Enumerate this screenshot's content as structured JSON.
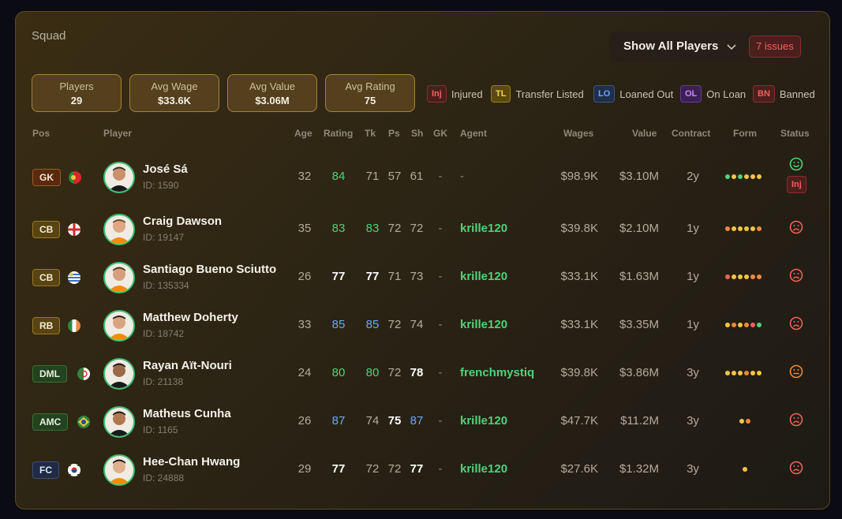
{
  "squad_title": "Squad",
  "filter": {
    "label": "Show All Players",
    "issues": "7 issues"
  },
  "stats": [
    {
      "label": "Players",
      "value": "29"
    },
    {
      "label": "Avg Wage",
      "value": "$33.6K"
    },
    {
      "label": "Avg Value",
      "value": "$3.06M"
    },
    {
      "label": "Avg Rating",
      "value": "75"
    }
  ],
  "legend": [
    {
      "code": "Inj",
      "text": "Injured"
    },
    {
      "code": "TL",
      "text": "Transfer Listed"
    },
    {
      "code": "LO",
      "text": "Loaned Out"
    },
    {
      "code": "OL",
      "text": "On Loan"
    },
    {
      "code": "BN",
      "text": "Banned"
    }
  ],
  "headers": {
    "pos": "Pos",
    "player": "Player",
    "age": "Age",
    "rating": "Rating",
    "tk": "Tk",
    "ps": "Ps",
    "sh": "Sh",
    "gk": "GK",
    "agent": "Agent",
    "wages": "Wages",
    "value": "Value",
    "contract": "Contract",
    "form": "Form",
    "status": "Status"
  },
  "players": [
    {
      "pos": "GK",
      "name": "José Sá",
      "id": "ID: 1590",
      "age": "32",
      "rating": "84",
      "tk": "71",
      "ps": "57",
      "sh": "61",
      "gk": "-",
      "agent": "-",
      "wages": "$98.9K",
      "value": "$3.10M",
      "contract": "2y",
      "status": "happy",
      "injured": "Inj"
    },
    {
      "pos": "CB",
      "name": "Craig Dawson",
      "id": "ID: 19147",
      "age": "35",
      "rating": "83",
      "tk": "83",
      "ps": "72",
      "sh": "72",
      "gk": "-",
      "agent": "krille120",
      "wages": "$39.8K",
      "value": "$2.10M",
      "contract": "1y",
      "status": "sad"
    },
    {
      "pos": "CB",
      "name": "Santiago Bueno Sciutto",
      "id": "ID: 135334",
      "age": "26",
      "rating": "77",
      "tk": "77",
      "ps": "71",
      "sh": "73",
      "gk": "-",
      "agent": "krille120",
      "wages": "$33.1K",
      "value": "$1.63M",
      "contract": "1y",
      "status": "sad"
    },
    {
      "pos": "RB",
      "name": "Matthew Doherty",
      "id": "ID: 18742",
      "age": "33",
      "rating": "85",
      "tk": "85",
      "ps": "72",
      "sh": "74",
      "gk": "-",
      "agent": "krille120",
      "wages": "$33.1K",
      "value": "$3.35M",
      "contract": "1y",
      "status": "sad"
    },
    {
      "pos": "DML",
      "name": "Rayan Aït-Nouri",
      "id": "ID: 21138",
      "age": "24",
      "rating": "80",
      "tk": "80",
      "ps": "72",
      "sh": "78",
      "gk": "-",
      "agent": "frenchmystiq",
      "wages": "$39.8K",
      "value": "$3.86M",
      "contract": "3y",
      "status": "neutral"
    },
    {
      "pos": "AMC",
      "name": "Matheus Cunha",
      "id": "ID: 1165",
      "age": "26",
      "rating": "87",
      "tk": "74",
      "ps": "75",
      "sh": "87",
      "gk": "-",
      "agent": "krille120",
      "wages": "$47.7K",
      "value": "$11.2M",
      "contract": "3y",
      "status": "sad"
    },
    {
      "pos": "FC",
      "name": "Hee-Chan Hwang",
      "id": "ID: 24888",
      "age": "29",
      "rating": "77",
      "tk": "72",
      "ps": "72",
      "sh": "77",
      "gk": "-",
      "agent": "krille120",
      "wages": "$27.6K",
      "value": "$1.32M",
      "contract": "3y",
      "status": "sad"
    }
  ],
  "colors": {
    "green": "#4ed37a",
    "blue": "#6ea5ff",
    "red": "#f0625b",
    "orange": "#f08a3c",
    "yellow": "#f5c542"
  }
}
